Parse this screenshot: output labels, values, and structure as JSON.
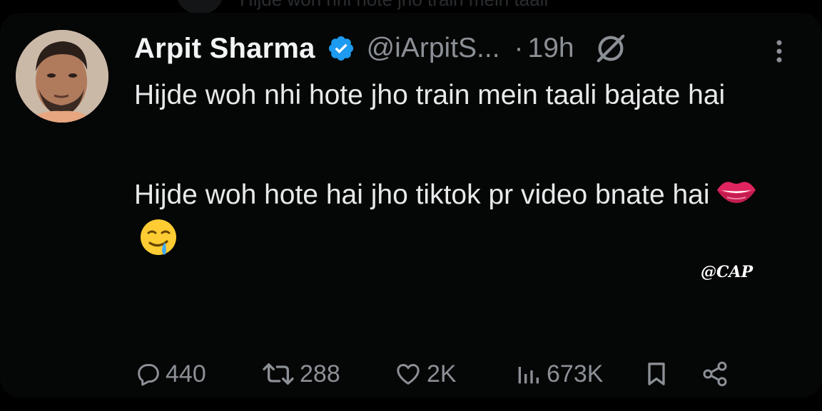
{
  "background_tweet": {
    "text": "Hijde woh nhi hote jho train mein taali"
  },
  "tweet": {
    "author_name": "Arpit Sharma",
    "handle": "@iArpitS...",
    "separator": "·",
    "time": "19h",
    "paragraphs": [
      "Hijde woh nhi hote jho train mein taali bajate hai",
      "Hijde woh hote hai jho tiktok pr video bnate hai"
    ],
    "emojis": [
      "lips-emoji",
      "drooling-face-emoji"
    ],
    "stats": {
      "replies": "440",
      "reposts": "288",
      "likes": "2K",
      "views": "673K"
    }
  },
  "watermark": "@CAP",
  "colors": {
    "background": "#000000",
    "text_primary": "#e7e9ea",
    "text_secondary": "#8b9096",
    "verified_badge": "#1d9bf0"
  },
  "icons": [
    "verified-badge-icon",
    "grok-icon",
    "more-icon",
    "reply-icon",
    "repost-icon",
    "like-icon",
    "views-icon",
    "bookmark-icon",
    "share-icon"
  ]
}
